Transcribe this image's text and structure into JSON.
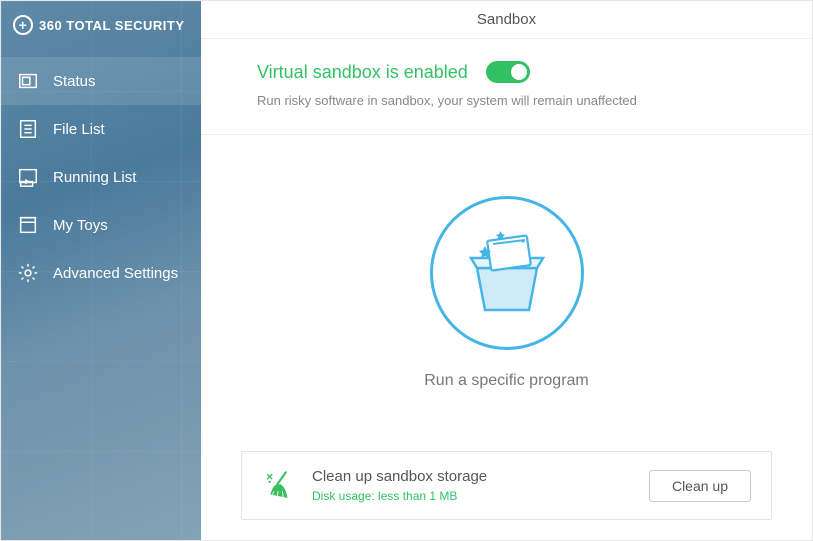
{
  "brand": {
    "name": "360 TOTAL SECURITY"
  },
  "titlebar": {
    "title": "Sandbox"
  },
  "sidebar": {
    "items": [
      {
        "label": "Status"
      },
      {
        "label": "File List"
      },
      {
        "label": "Running List"
      },
      {
        "label": "My Toys"
      },
      {
        "label": "Advanced Settings"
      }
    ]
  },
  "status": {
    "title": "Virtual sandbox is enabled",
    "subtitle": "Run risky software in sandbox, your system will remain unaffected",
    "enabled": true
  },
  "hero": {
    "caption": "Run a specific program"
  },
  "cleanup": {
    "title": "Clean up sandbox storage",
    "subtitle": "Disk usage: less than 1 MB",
    "button": "Clean up"
  },
  "colors": {
    "accent_green": "#32c266",
    "accent_blue": "#45b5e6"
  }
}
